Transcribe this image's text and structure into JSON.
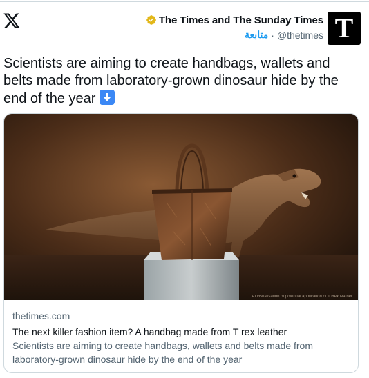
{
  "header": {
    "display_name": "The Times and The Sunday Times",
    "follow_label": "متابعة",
    "separator": "·",
    "handle": "@thetimes",
    "avatar_letter": "T"
  },
  "icons": {
    "logo": "x-logo-icon",
    "verified": "verified-badge-icon",
    "emoji": "down-arrow-emoji-icon"
  },
  "tweet": {
    "text": "Scientists are aiming to create handbags, wallets and belts made from laboratory-grown dinosaur hide by the end of the year"
  },
  "card": {
    "domain": "thetimes.com",
    "title": "The next killer fashion item? A handbag made from T rex leather",
    "description": "Scientists are aiming to create handbags, wallets and belts made from laboratory-grown dinosaur hide by the end of the year",
    "image_caption": "AI visualisation of potential application of T Rex leather"
  },
  "colors": {
    "accent": "#1d9bf0",
    "verified_gold": "#e2b719",
    "text_primary": "#0f1419",
    "text_secondary": "#536471",
    "border": "#cfd9de"
  }
}
